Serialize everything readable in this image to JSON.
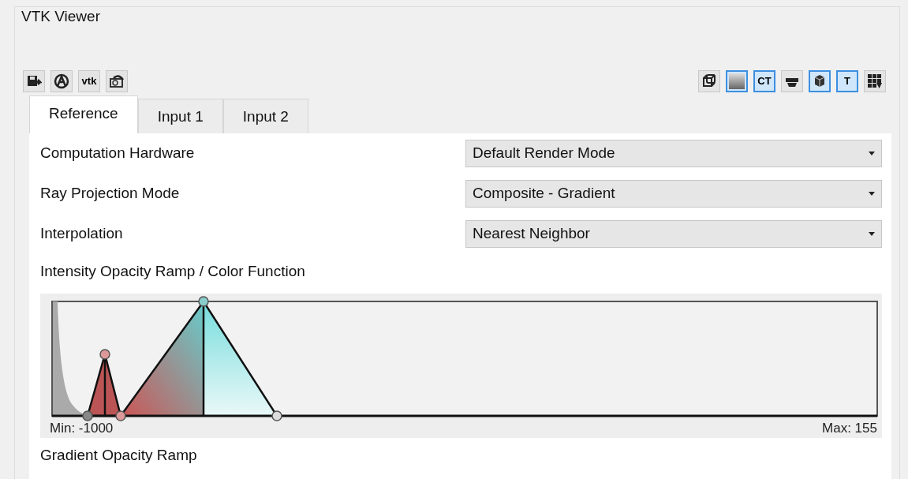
{
  "group_title": "VTK Viewer",
  "toolbar_left": [
    {
      "kind": "save",
      "on": false
    },
    {
      "kind": "annotate",
      "on": false
    },
    {
      "kind": "text",
      "label": "vtk",
      "on": false
    },
    {
      "kind": "camera",
      "on": false
    }
  ],
  "toolbar_right": [
    {
      "kind": "cube",
      "on": false
    },
    {
      "kind": "gradient",
      "on": true
    },
    {
      "kind": "text",
      "label": "CT",
      "on": true
    },
    {
      "kind": "layers",
      "on": false
    },
    {
      "kind": "volume",
      "on": true
    },
    {
      "kind": "text",
      "label": "T",
      "on": true
    },
    {
      "kind": "grid",
      "on": false
    }
  ],
  "tabs": [
    {
      "label": "Reference",
      "selected": true
    },
    {
      "label": "Input 1",
      "selected": false
    },
    {
      "label": "Input 2",
      "selected": false
    }
  ],
  "settings": [
    {
      "label": "Computation Hardware",
      "value": "Default Render Mode"
    },
    {
      "label": "Ray Projection Mode",
      "value": "Composite - Gradient"
    },
    {
      "label": "Interpolation",
      "value": "Nearest Neighbor"
    }
  ],
  "ramp": {
    "title": "Intensity Opacity Ramp / Color Function",
    "min_label": "Min: -1000",
    "max_label": "Max: 155"
  },
  "gradient_title": "Gradient Opacity Ramp"
}
